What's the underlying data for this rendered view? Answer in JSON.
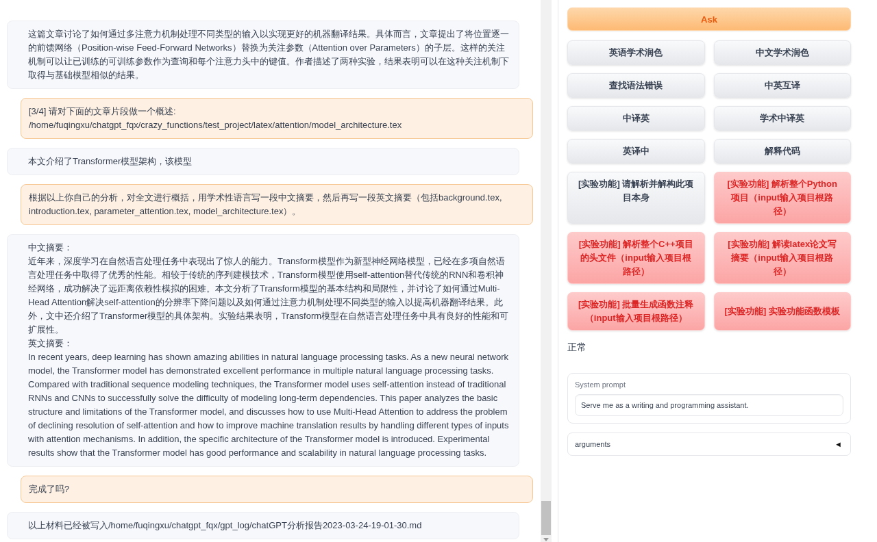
{
  "chat": {
    "messages": [
      {
        "kind": "bot",
        "lines": [
          "这篇文章讨论了如何通过多注意力机制处理不同类型的输入以实现更好的机器翻译结果。具体而言，文章提出了将位置逐一的前馈网络（Position-wise Feed-Forward Networks）替换为关注参数（Attention over Parameters）的子层。这样的关注机制可以让已训练的可训练参数作为查询和每个注意力头中的键值。作者描述了两种实验，结果表明可以在这种关注机制下取得与基础模型相似的结果。"
        ]
      },
      {
        "kind": "user",
        "lines": [
          "[3/4] 请对下面的文章片段做一个概述:",
          "/home/fuqingxu/chatgpt_fqx/crazy_functions/test_project/latex/attention/model_architecture.tex"
        ]
      },
      {
        "kind": "bot",
        "lines": [
          "本文介绍了Transformer模型架构，该模型"
        ]
      },
      {
        "kind": "user",
        "lines": [
          "根据以上你自己的分析，对全文进行概括，用学术性语言写一段中文摘要，然后再写一段英文摘要（包括background.tex, introduction.tex, parameter_attention.tex, model_architecture.tex）。"
        ]
      },
      {
        "kind": "bot",
        "lines": [
          "中文摘要：",
          "近年来，深度学习在自然语言处理任务中表现出了惊人的能力。Transform模型作为新型神经网络模型，已经在多项自然语言处理任务中取得了优秀的性能。相较于传统的序列建模技术，Transform模型使用self-attention替代传统的RNN和卷积神经网络，成功解决了远距离依赖性模拟的困难。本文分析了Transform模型的基本结构和局限性，并讨论了如何通过Multi-Head Attention解决self-attention的分辨率下降问题以及如何通过注意力机制处理不同类型的输入以提高机器翻译结果。此外，文中还介绍了Transformer模型的具体架构。实验结果表明，Transform模型在自然语言处理任务中具有良好的性能和可扩展性。",
          "英文摘要：",
          "In recent years, deep learning has shown amazing abilities in natural language processing tasks. As a new neural network model, the Transformer model has demonstrated excellent performance in multiple natural language processing tasks. Compared with traditional sequence modeling techniques, the Transformer model uses self-attention instead of traditional RNNs and CNNs to successfully solve the difficulty of modeling long-term dependencies. This paper analyzes the basic structure and limitations of the Transformer model, and discusses how to use Multi-Head Attention to address the problem of declining resolution of self-attention and how to improve machine translation results by handling different types of inputs with attention mechanisms. In addition, the specific architecture of the Transformer model is introduced. Experimental results show that the Transformer model has good performance and scalability in natural language processing tasks."
        ]
      },
      {
        "kind": "user",
        "lines": [
          "完成了吗?"
        ]
      },
      {
        "kind": "bot",
        "lines": [
          "以上材料已经被写入/home/fuqingxu/chatgpt_fqx/gpt_log/chatGPT分析报告2023-03-24-19-01-30.md"
        ]
      }
    ]
  },
  "ask_button": {
    "label": "Ask"
  },
  "function_buttons": [
    {
      "label": "英语学术润色",
      "kind": "basic"
    },
    {
      "label": "中文学术润色",
      "kind": "basic"
    },
    {
      "label": "查找语法错误",
      "kind": "basic"
    },
    {
      "label": "中英互译",
      "kind": "basic"
    },
    {
      "label": "中译英",
      "kind": "basic"
    },
    {
      "label": "学术中译英",
      "kind": "basic"
    },
    {
      "label": "英译中",
      "kind": "basic"
    },
    {
      "label": "解释代码",
      "kind": "basic"
    },
    {
      "label": "[实验功能] 请解析并解构此项目本身",
      "kind": "basic"
    },
    {
      "label": "[实验功能] 解析整个Python项目（input输入项目根路径）",
      "kind": "experimental"
    },
    {
      "label": "[实验功能] 解析整个C++项目的头文件（input输入项目根路径）",
      "kind": "experimental"
    },
    {
      "label": "[实验功能] 解读latex论文写摘要（input输入项目根路径）",
      "kind": "experimental"
    },
    {
      "label": "[实验功能] 批量生成函数注释（input输入项目根路径）",
      "kind": "experimental"
    },
    {
      "label": "[实验功能] 实验功能函数模板",
      "kind": "experimental"
    }
  ],
  "status": "正常",
  "system_prompt": {
    "label": "System prompt",
    "value": "Serve me as a writing and programming assistant."
  },
  "arguments_panel": {
    "label": "arguments",
    "toggle": "◄",
    "expanded": false
  }
}
